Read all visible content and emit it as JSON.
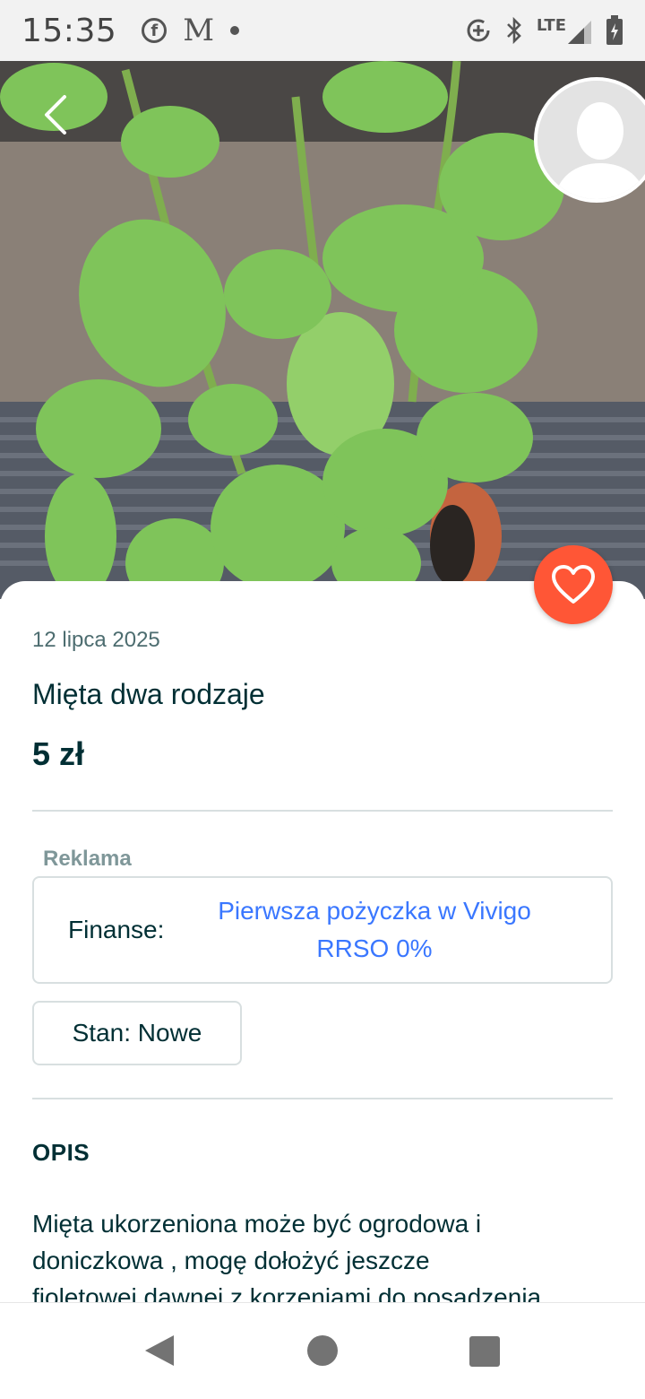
{
  "status_bar": {
    "time": "15:35",
    "facebook_glyph": "f",
    "gmail_glyph": "M",
    "network_label": "LTE",
    "icons": [
      "facebook-icon",
      "gmail-icon",
      "notification-dot-icon",
      "data-saver-icon",
      "bluetooth-icon",
      "signal-icon",
      "battery-icon"
    ]
  },
  "listing": {
    "date": "12 lipca 2025",
    "title": "Mięta dwa rodzaje",
    "price": "5 zł"
  },
  "ad": {
    "label": "Reklama",
    "category": "Finanse:",
    "link_line1": "Pierwsza pożyczka w Vivigo",
    "link_line2": "RRSO 0%"
  },
  "condition": {
    "label": "Stan: Nowe"
  },
  "description": {
    "heading": "OPIS",
    "line1": "Mięta ukorzeniona może być ogrodowa i",
    "line2": "doniczkowa , mogę dołożyć jeszcze",
    "line3": "fioletowej dawnej z korzeniami do posadzenia"
  },
  "colors": {
    "favorite_button": "#ff5636",
    "link": "#3a77ff",
    "text_primary": "#002f34"
  }
}
